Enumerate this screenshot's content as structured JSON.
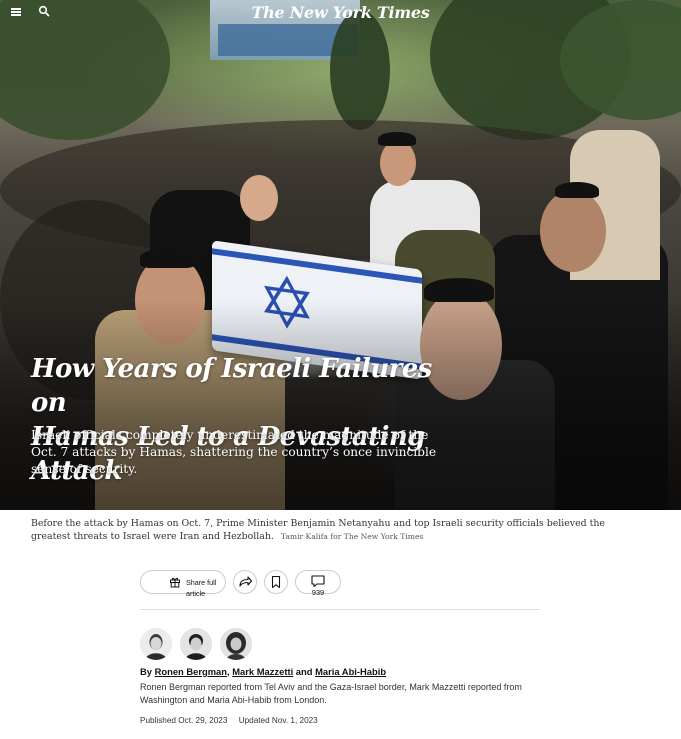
{
  "masthead": "The New York Times",
  "article": {
    "headline_line1": "How Years of Israeli Failures on",
    "headline_line2": "Hamas Led to a Devastating Attack",
    "summary": "Israeli officials completely underestimated the magnitude of the Oct. 7 attacks by Hamas, shattering the country’s once invincible sense of security.",
    "caption": "Before the attack by Hamas on Oct. 7, Prime Minister Benjamin Netanyahu and top Israeli security officials believed the greatest threats to Israel were Iran and Hezbollah.",
    "photo_credit": "Tamir Kalifa for The New York Times"
  },
  "actions": {
    "share_full_article_label": "Share full article",
    "comment_count": "939"
  },
  "byline": {
    "prefix": "By",
    "authors": [
      "Ronen Bergman",
      "Mark Mazzetti",
      "Maria Abi-Habib"
    ],
    "separator": ",",
    "conjunction": "and",
    "reported": "Ronen Bergman reported from Tel Aviv and the Gaza-Israel border, Mark Mazzetti reported from Washington and Maria Abi-Habib from London."
  },
  "dates": {
    "published": "Published Oct. 29, 2023",
    "updated": "Updated Nov. 1, 2023"
  },
  "colors": {
    "flag_blue": "#2c55b8",
    "text": "#121212",
    "divider": "#dfdfdf"
  },
  "icons": [
    "menu-icon",
    "search-icon",
    "gift-icon",
    "share-icon",
    "bookmark-icon",
    "comment-icon"
  ]
}
